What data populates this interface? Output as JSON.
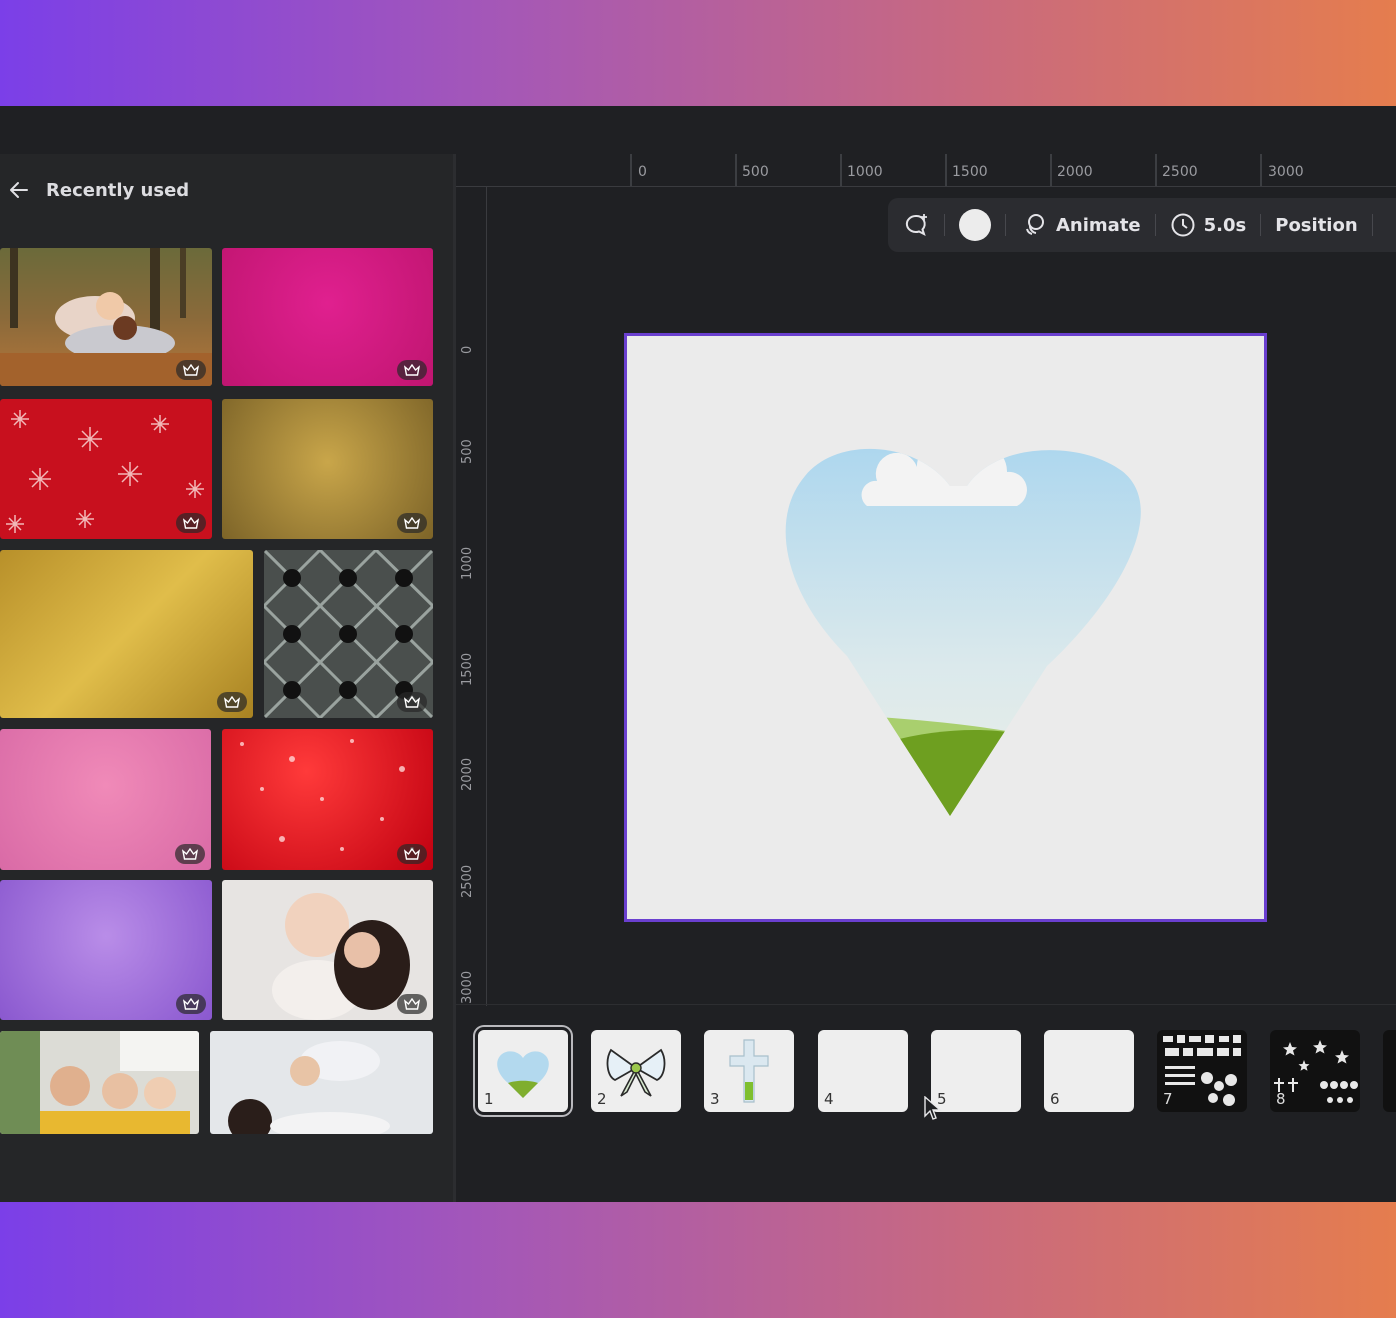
{
  "panel": {
    "back_label": "←",
    "title": "Recently used",
    "tiles": [
      {
        "id": "family-autumn",
        "premium": true
      },
      {
        "id": "pink-glitter",
        "premium": true
      },
      {
        "id": "red-snowflakes",
        "premium": true
      },
      {
        "id": "gold-sparkle",
        "premium": true
      },
      {
        "id": "gold-foil",
        "premium": true
      },
      {
        "id": "geometric-pattern",
        "premium": true
      },
      {
        "id": "pink-sparkle",
        "premium": true
      },
      {
        "id": "red-glitter",
        "premium": true
      },
      {
        "id": "purple-glitter",
        "premium": true
      },
      {
        "id": "mother-baby",
        "premium": true
      },
      {
        "id": "family-photo",
        "premium": false
      },
      {
        "id": "baby-lift",
        "premium": false
      }
    ]
  },
  "ruler": {
    "top": [
      "0",
      "500",
      "1000",
      "1500",
      "2000",
      "2500",
      "3000"
    ],
    "left": [
      "0",
      "500",
      "1000",
      "1500",
      "2000",
      "2500",
      "3000"
    ]
  },
  "toolbar": {
    "animate_label": "Animate",
    "duration_label": "5.0s",
    "position_label": "Position",
    "color": "#ececec"
  },
  "pages": [
    {
      "num": "1",
      "active": true
    },
    {
      "num": "2",
      "active": false
    },
    {
      "num": "3",
      "active": false
    },
    {
      "num": "4",
      "active": false
    },
    {
      "num": "5",
      "active": false
    },
    {
      "num": "6",
      "active": false
    },
    {
      "num": "7",
      "active": false
    },
    {
      "num": "8",
      "active": false
    }
  ],
  "colors": {
    "accent": "#6a3fcf",
    "panel": "#252628",
    "background": "#1f2023"
  }
}
